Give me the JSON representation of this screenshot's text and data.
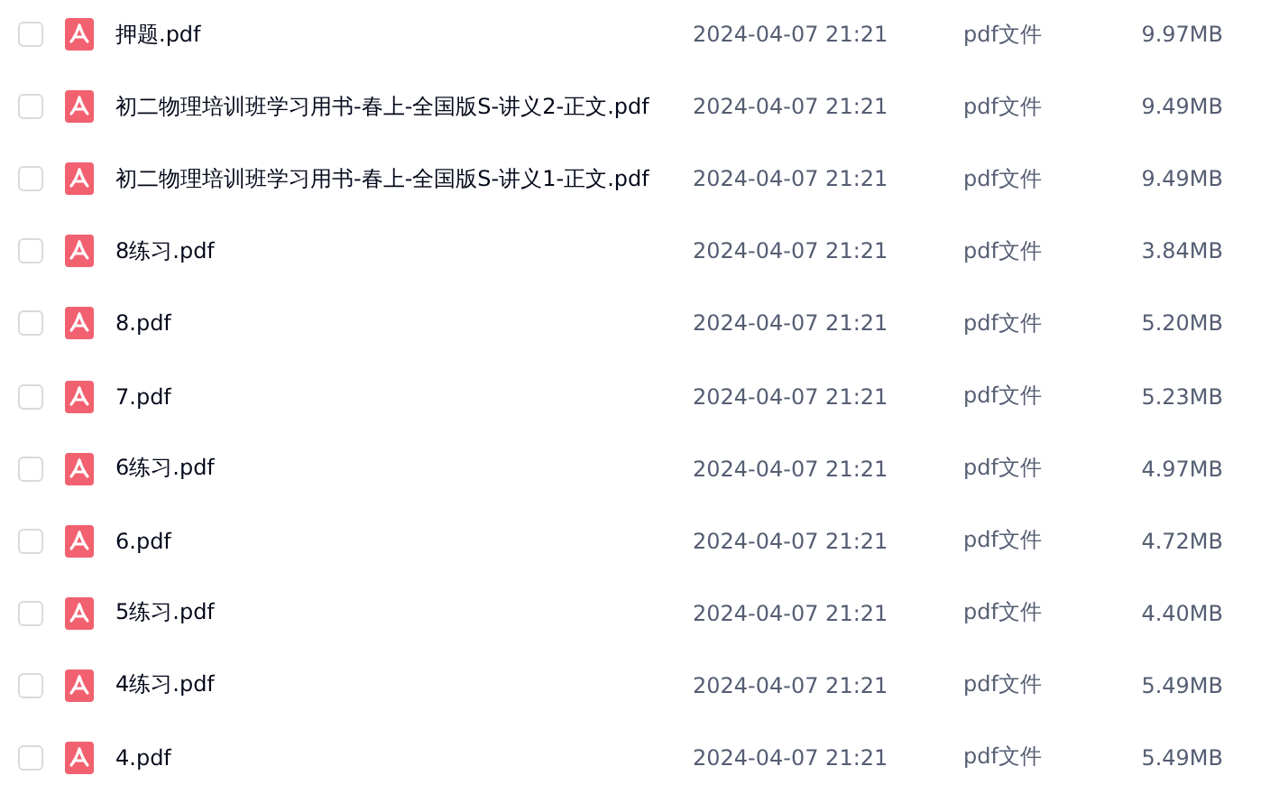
{
  "files": [
    {
      "checked": false,
      "name": "押题.pdf",
      "modified": "2024-04-07 21:21",
      "type": "pdf文件",
      "size": "9.97MB"
    },
    {
      "checked": false,
      "name": "初二物理培训班学习用书-春上-全国版S-讲义2-正文.pdf",
      "modified": "2024-04-07 21:21",
      "type": "pdf文件",
      "size": "9.49MB"
    },
    {
      "checked": false,
      "name": "初二物理培训班学习用书-春上-全国版S-讲义1-正文.pdf",
      "modified": "2024-04-07 21:21",
      "type": "pdf文件",
      "size": "9.49MB"
    },
    {
      "checked": false,
      "name": "8练习.pdf",
      "modified": "2024-04-07 21:21",
      "type": "pdf文件",
      "size": "3.84MB"
    },
    {
      "checked": false,
      "name": "8.pdf",
      "modified": "2024-04-07 21:21",
      "type": "pdf文件",
      "size": "5.20MB"
    },
    {
      "checked": false,
      "name": "7.pdf",
      "modified": "2024-04-07 21:21",
      "type": "pdf文件",
      "size": "5.23MB"
    },
    {
      "checked": false,
      "name": "6练习.pdf",
      "modified": "2024-04-07 21:21",
      "type": "pdf文件",
      "size": "4.97MB"
    },
    {
      "checked": false,
      "name": "6.pdf",
      "modified": "2024-04-07 21:21",
      "type": "pdf文件",
      "size": "4.72MB"
    },
    {
      "checked": false,
      "name": "5练习.pdf",
      "modified": "2024-04-07 21:21",
      "type": "pdf文件",
      "size": "4.40MB"
    },
    {
      "checked": false,
      "name": "4练习.pdf",
      "modified": "2024-04-07 21:21",
      "type": "pdf文件",
      "size": "5.49MB"
    },
    {
      "checked": false,
      "name": "4.pdf",
      "modified": "2024-04-07 21:21",
      "type": "pdf文件",
      "size": "5.49MB"
    }
  ]
}
